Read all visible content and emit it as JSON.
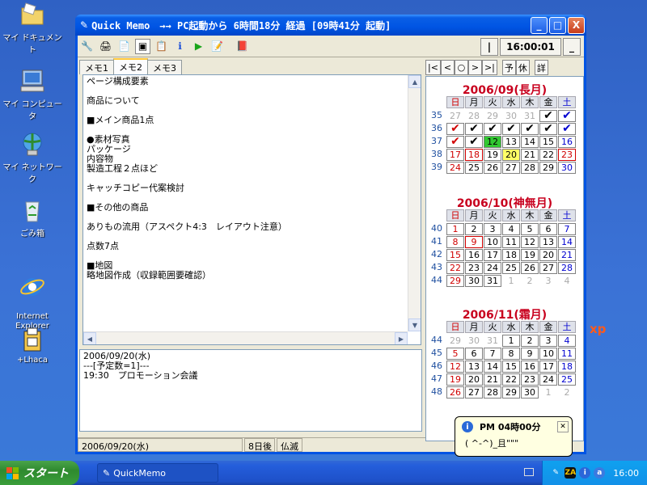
{
  "desktop": {
    "icons": [
      {
        "label": "マイ ドキュメント",
        "icon": "folder-icon"
      },
      {
        "label": "マイ コンピュータ",
        "icon": "computer-icon"
      },
      {
        "label": "マイ ネットワーク",
        "icon": "network-icon"
      },
      {
        "label": "ごみ箱",
        "icon": "recycle-bin-icon"
      },
      {
        "label": "Internet\nExplorer",
        "icon": "ie-icon"
      },
      {
        "label": "+Lhaca",
        "icon": "lhaca-icon"
      }
    ],
    "stray_text": "xp"
  },
  "window": {
    "title": "Quick Memo　→→ PC起動から 6時間18分 経過 [09時41分 起動]",
    "controls": {
      "minimize": "_",
      "maximize": "□",
      "close": "X"
    },
    "clock": {
      "left_btn": "|",
      "time": "16:00:01",
      "right_btn": "_"
    }
  },
  "tabs": [
    "メモ1",
    "メモ2",
    "メモ3"
  ],
  "active_tab": 1,
  "memo_text": "ページ構成要素\n\n商品について\n\n■メイン商品1点\n\n●素材写真\nパッケージ\n内容物\n製造工程２点ほど\n\nキャッチコピー代案検討\n\n■その他の商品\n\nありもの流用（アスペクト4:3　レイアウト注意）\n\n点数7点\n\n■地図\n略地図作成（収録範囲要確認）",
  "schedule_text": "2006/09/20(水)\n---[予定数=1]---\n19:30　プロモーション会議",
  "status": {
    "date": "2006/09/20(水)",
    "days": "8日後",
    "rokuyo": "仏滅"
  },
  "nav": {
    "buttons": [
      "|<",
      "<",
      "○",
      ">",
      ">|"
    ],
    "yotei": "予",
    "kyuu": "休",
    "detail": "詳"
  },
  "calendar": {
    "weekday_headers": [
      "日",
      "月",
      "火",
      "水",
      "木",
      "金",
      "土"
    ],
    "months": [
      {
        "title": "2006/09(長月)",
        "weeks": [
          35,
          36,
          37,
          38,
          39
        ],
        "days": [
          [
            "27",
            "28",
            "29",
            "30",
            "31",
            "✔",
            "✔"
          ],
          [
            "✔",
            "✔",
            "✔",
            "✔",
            "✔",
            "✔",
            "✔"
          ],
          [
            "✔",
            "✔",
            "12",
            "13",
            "14",
            "15",
            "16"
          ],
          [
            "17",
            "18",
            "19",
            "20",
            "21",
            "22",
            "23"
          ],
          [
            "24",
            "25",
            "26",
            "27",
            "28",
            "29",
            "30"
          ]
        ]
      },
      {
        "title": "2006/10(神無月)",
        "weeks": [
          40,
          41,
          42,
          43,
          44
        ],
        "days": [
          [
            "1",
            "2",
            "3",
            "4",
            "5",
            "6",
            "7"
          ],
          [
            "8",
            "9",
            "10",
            "11",
            "12",
            "13",
            "14"
          ],
          [
            "15",
            "16",
            "17",
            "18",
            "19",
            "20",
            "21"
          ],
          [
            "22",
            "23",
            "24",
            "25",
            "26",
            "27",
            "28"
          ],
          [
            "29",
            "30",
            "31",
            "1",
            "2",
            "3",
            "4"
          ]
        ]
      },
      {
        "title": "2006/11(霜月)",
        "weeks": [
          44,
          45,
          46,
          47,
          48
        ],
        "days": [
          [
            "29",
            "30",
            "31",
            "1",
            "2",
            "3",
            "4"
          ],
          [
            "5",
            "6",
            "7",
            "8",
            "9",
            "10",
            "11"
          ],
          [
            "12",
            "13",
            "14",
            "15",
            "16",
            "17",
            "18"
          ],
          [
            "19",
            "20",
            "21",
            "22",
            "23",
            "24",
            "25"
          ],
          [
            "26",
            "27",
            "28",
            "29",
            "30",
            "1",
            "2"
          ]
        ]
      }
    ]
  },
  "tooltip": {
    "title": "PM 04時00分",
    "body": "( ^-^)_且\"\"\"",
    "close": "✕"
  },
  "taskbar": {
    "start": "スタート",
    "task": "QuickMemo",
    "clock": "16:00"
  }
}
